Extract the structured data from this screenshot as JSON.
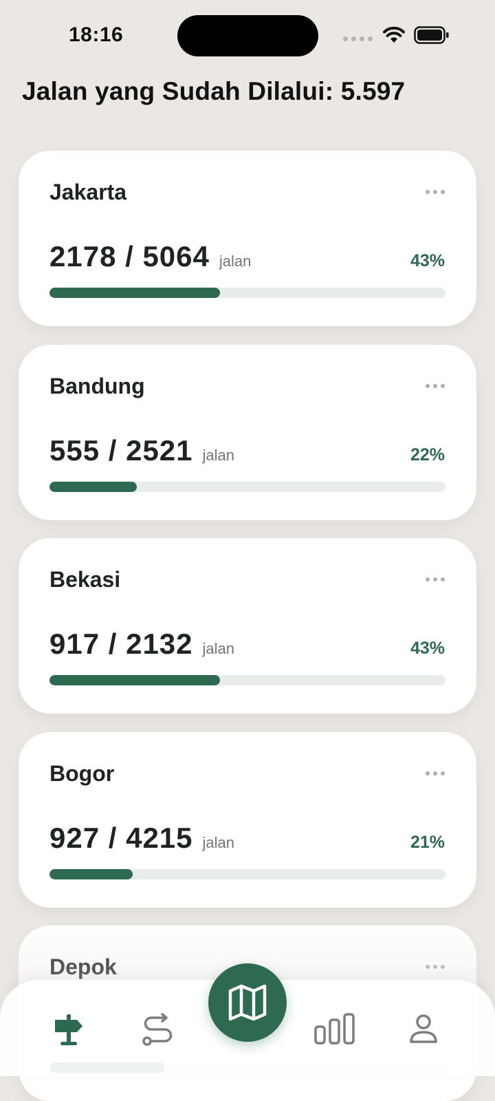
{
  "status_bar": {
    "time": "18:16"
  },
  "header": {
    "title": "Jalan yang Sudah Dilalui: 5.597"
  },
  "theme": {
    "accent": "#2d6a50",
    "background": "#ebe8e4",
    "card": "#ffffff",
    "track": "#e8ecea"
  },
  "cities": [
    {
      "name": "Jakarta",
      "count": "2178 / 5064",
      "unit": "jalan",
      "percent_label": "43%",
      "progress": 0.43
    },
    {
      "name": "Bandung",
      "count": "555 / 2521",
      "unit": "jalan",
      "percent_label": "22%",
      "progress": 0.22
    },
    {
      "name": "Bekasi",
      "count": "917 / 2132",
      "unit": "jalan",
      "percent_label": "43%",
      "progress": 0.43
    },
    {
      "name": "Bogor",
      "count": "927 / 4215",
      "unit": "jalan",
      "percent_label": "21%",
      "progress": 0.21
    },
    {
      "name": "Depok",
      "count": "",
      "unit": "",
      "percent_label": "",
      "progress": 0.29
    }
  ],
  "nav": {
    "items": [
      {
        "icon": "signpost-icon",
        "active": true
      },
      {
        "icon": "route-icon",
        "active": false
      },
      {
        "icon": "map-icon",
        "active": false
      },
      {
        "icon": "bar-chart-icon",
        "active": false
      },
      {
        "icon": "profile-icon",
        "active": false
      }
    ]
  }
}
